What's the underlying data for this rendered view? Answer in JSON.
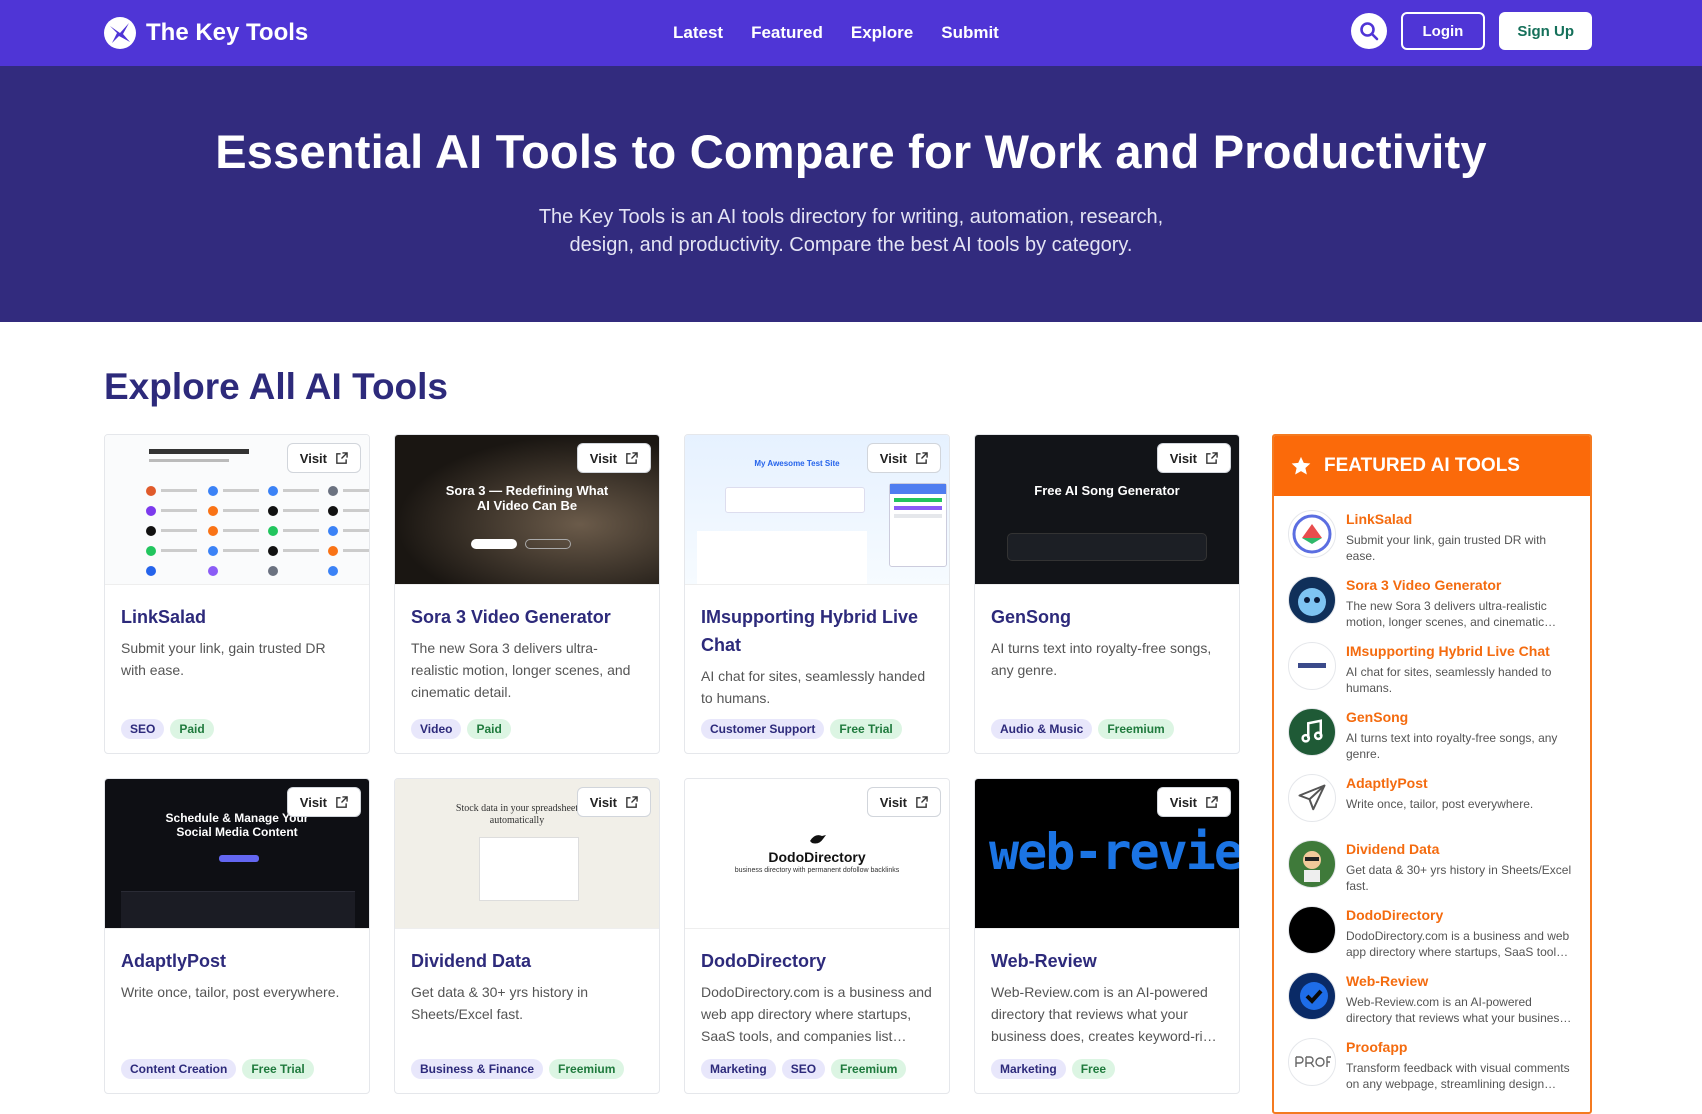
{
  "nav": {
    "brand": "The Key Tools",
    "links": [
      "Latest",
      "Featured",
      "Explore",
      "Submit"
    ],
    "login": "Login",
    "signup": "Sign Up"
  },
  "hero": {
    "title": "Essential AI Tools to Compare for Work and Productivity",
    "subtitle": "The Key Tools is an AI tools directory for writing, automation, research, design, and productivity. Compare the best AI tools by category."
  },
  "main": {
    "title": "Explore All AI Tools",
    "visit_label": "Visit",
    "cards": [
      {
        "title": "LinkSalad",
        "desc": "Submit your link, gain trusted DR with ease.",
        "tags": [
          "SEO"
        ],
        "price": "Paid"
      },
      {
        "title": "Sora 3 Video Generator",
        "desc": "The new Sora 3 delivers ultra-realistic motion, longer scenes, and cinematic detail.",
        "tags": [
          "Video"
        ],
        "price": "Paid",
        "thumb_text": "Sora 3 — Redefining What AI Video Can Be"
      },
      {
        "title": "IMsupporting Hybrid Live Chat",
        "desc": "AI chat for sites, seamlessly handed to humans.",
        "tags": [
          "Customer Support"
        ],
        "price": "Free Trial",
        "thumb_text": "My Awesome Test Site"
      },
      {
        "title": "GenSong",
        "desc": "AI turns text into royalty-free songs, any genre.",
        "tags": [
          "Audio & Music"
        ],
        "price": "Freemium",
        "thumb_text": "Free AI Song Generator"
      },
      {
        "title": "AdaptlyPost",
        "desc": "Write once, tailor, post everywhere.",
        "tags": [
          "Content Creation"
        ],
        "price": "Free Trial",
        "thumb_text": "Schedule & Manage Your Social Media Content"
      },
      {
        "title": "Dividend Data",
        "desc": "Get data & 30+ yrs history in Sheets/Excel fast.",
        "tags": [
          "Business & Finance"
        ],
        "price": "Freemium",
        "thumb_text": "Stock data in your spreadsheet automatically"
      },
      {
        "title": "DodoDirectory",
        "desc": "DodoDirectory.com is a business and web app directory where startups, SaaS tools, and companies list…",
        "tags": [
          "Marketing",
          "SEO"
        ],
        "price": "Freemium",
        "thumb_text": "DodoDirectory",
        "thumb_sub": "business directory with permanent dofollow backlinks"
      },
      {
        "title": "Web-Review",
        "desc": "Web-Review.com is an AI-powered directory that reviews what your business does, creates keyword-ri…",
        "tags": [
          "Marketing"
        ],
        "price": "Free",
        "thumb_text": "web-review"
      }
    ]
  },
  "featured": {
    "title": "FEATURED AI TOOLS",
    "items": [
      {
        "name": "LinkSalad",
        "desc": "Submit your link, gain trusted DR with ease."
      },
      {
        "name": "Sora 3 Video Generator",
        "desc": "The new Sora 3 delivers ultra-realistic motion, longer scenes, and cinematic…"
      },
      {
        "name": "IMsupporting Hybrid Live Chat",
        "desc": "AI chat for sites, seamlessly handed to humans."
      },
      {
        "name": "GenSong",
        "desc": "AI turns text into royalty-free songs, any genre."
      },
      {
        "name": "AdaptlyPost",
        "desc": "Write once, tailor, post everywhere."
      },
      {
        "name": "Dividend Data",
        "desc": "Get data & 30+ yrs history in Sheets/Excel fast."
      },
      {
        "name": "DodoDirectory",
        "desc": "DodoDirectory.com is a business and web app directory where startups, SaaS tool…"
      },
      {
        "name": "Web-Review",
        "desc": "Web-Review.com is an AI-powered directory that reviews what your busines…"
      },
      {
        "name": "Proofapp",
        "desc": "Transform feedback with visual comments on any webpage, streamlining design…"
      }
    ]
  },
  "colors": {
    "nav": "#4f35d6",
    "hero": "#322b7e",
    "accent": "#fb6a0a",
    "title": "#2d2a7b"
  }
}
